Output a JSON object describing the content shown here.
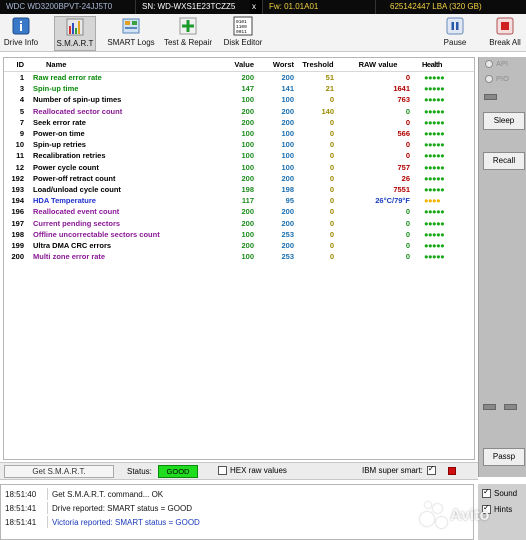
{
  "infobar": {
    "model": "WDC WD3200BPVT-24JJ5T0",
    "serial": "SN: WD-WXS1E23TCZZ5",
    "close": "x",
    "firmware": "Fw: 01.01A01",
    "lba": "625142447 LBA (320 GB)"
  },
  "toolbar": {
    "drive_info": "Drive Info",
    "smart": "S.M.A.R.T",
    "smart_logs": "SMART Logs",
    "test_repair": "Test & Repair",
    "disk_editor": "Disk Editor",
    "pause": "Pause",
    "break_all": "Break All",
    "disk_editor_icon_text": "010110\n1100\n01"
  },
  "grid": {
    "headers": {
      "id": "ID",
      "name": "Name",
      "value": "Value",
      "worst": "Worst",
      "threshold": "Treshold",
      "raw": "RAW value",
      "health": "Health"
    },
    "rows": [
      {
        "id": "1",
        "name": "Raw read error rate",
        "value": "200",
        "worst": "200",
        "threshold": "51",
        "raw": "0",
        "health": "●●●●●"
      },
      {
        "id": "3",
        "name": "Spin-up time",
        "value": "147",
        "worst": "141",
        "threshold": "21",
        "raw": "1641",
        "health": "●●●●●"
      },
      {
        "id": "4",
        "name": "Number of spin-up times",
        "value": "100",
        "worst": "100",
        "threshold": "0",
        "raw": "763",
        "health": "●●●●●"
      },
      {
        "id": "5",
        "name": "Reallocated sector count",
        "value": "200",
        "worst": "200",
        "threshold": "140",
        "raw": "0",
        "health": "●●●●●"
      },
      {
        "id": "7",
        "name": "Seek error rate",
        "value": "200",
        "worst": "200",
        "threshold": "0",
        "raw": "0",
        "health": "●●●●●"
      },
      {
        "id": "9",
        "name": "Power-on time",
        "value": "100",
        "worst": "100",
        "threshold": "0",
        "raw": "566",
        "health": "●●●●●"
      },
      {
        "id": "10",
        "name": "Spin-up retries",
        "value": "100",
        "worst": "100",
        "threshold": "0",
        "raw": "0",
        "health": "●●●●●"
      },
      {
        "id": "11",
        "name": "Recalibration retries",
        "value": "100",
        "worst": "100",
        "threshold": "0",
        "raw": "0",
        "health": "●●●●●"
      },
      {
        "id": "12",
        "name": "Power cycle count",
        "value": "100",
        "worst": "100",
        "threshold": "0",
        "raw": "757",
        "health": "●●●●●"
      },
      {
        "id": "192",
        "name": "Power-off retract count",
        "value": "200",
        "worst": "200",
        "threshold": "0",
        "raw": "26",
        "health": "●●●●●"
      },
      {
        "id": "193",
        "name": "Load/unload cycle count",
        "value": "198",
        "worst": "198",
        "threshold": "0",
        "raw": "7551",
        "health": "●●●●●"
      },
      {
        "id": "194",
        "name": "HDA Temperature",
        "value": "117",
        "worst": "95",
        "threshold": "0",
        "raw": "26°C/79°F",
        "health": "●●●●"
      },
      {
        "id": "196",
        "name": "Reallocated event count",
        "value": "200",
        "worst": "200",
        "threshold": "0",
        "raw": "0",
        "health": "●●●●●"
      },
      {
        "id": "197",
        "name": "Current pending sectors",
        "value": "200",
        "worst": "200",
        "threshold": "0",
        "raw": "0",
        "health": "●●●●●"
      },
      {
        "id": "198",
        "name": "Offline uncorrectable sectors count",
        "value": "100",
        "worst": "253",
        "threshold": "0",
        "raw": "0",
        "health": "●●●●●"
      },
      {
        "id": "199",
        "name": "Ultra DMA CRC errors",
        "value": "200",
        "worst": "200",
        "threshold": "0",
        "raw": "0",
        "health": "●●●●●"
      },
      {
        "id": "200",
        "name": "Multi zone error rate",
        "value": "100",
        "worst": "253",
        "threshold": "0",
        "raw": "0",
        "health": "●●●●●"
      }
    ]
  },
  "rpanel": {
    "api": "API",
    "pio": "PIO",
    "sleep": "Sleep",
    "recall": "Recall",
    "passp": "Passp"
  },
  "statusbar": {
    "get_smart": "Get S.M.A.R.T.",
    "status_label": "Status:",
    "status_value": "GOOD",
    "hex_raw": "HEX raw values",
    "ibm_super": "IBM super smart:"
  },
  "log": [
    {
      "time": "18:51:40",
      "msg": "Get S.M.A.R.T. command... OK"
    },
    {
      "time": "18:51:41",
      "msg": "Drive reported: SMART status = GOOD"
    },
    {
      "time": "18:51:41",
      "msg": "Victoria reported: SMART status = GOOD"
    }
  ],
  "bottom_right": {
    "sound": "Sound",
    "hints": "Hints"
  },
  "watermark": "Avito",
  "colors": {
    "status_good": "#1fdc1f",
    "name_green": "#0a8a0a",
    "name_purple": "#8a1a96",
    "name_blue": "#2030d0",
    "raw_red": "#b00000"
  }
}
